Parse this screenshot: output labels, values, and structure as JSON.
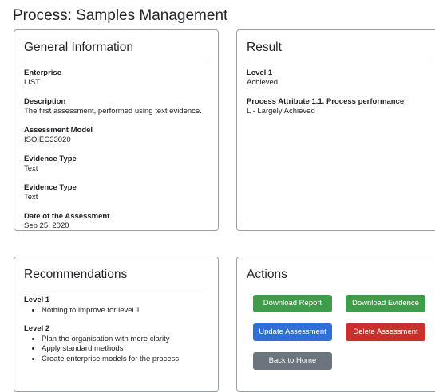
{
  "page": {
    "title": "Process: Samples Management"
  },
  "general_info": {
    "heading": "General Information",
    "fields": [
      {
        "label": "Enterprise",
        "value": "LIST"
      },
      {
        "label": "Description",
        "value": "The first assessment, performed using text evidence."
      },
      {
        "label": "Assessment Model",
        "value": "ISOIEC33020"
      },
      {
        "label": "Evidence Type",
        "value": "Text"
      },
      {
        "label": "Evidence Type",
        "value": "Text"
      },
      {
        "label": "Date of the Assessment",
        "value": "Sep 25, 2020"
      }
    ]
  },
  "result": {
    "heading": "Result",
    "items": [
      {
        "label": "Level 1",
        "value": "Achieved"
      },
      {
        "label": "Process Attribute 1.1. Process performance",
        "value": "L - Largely Achieved"
      }
    ]
  },
  "recommendations": {
    "heading": "Recommendations",
    "groups": [
      {
        "label": "Level 1",
        "items": [
          "Nothing to improve for level 1"
        ]
      },
      {
        "label": "Level 2",
        "items": [
          "Plan the organisation with more clarity",
          "Apply standard methods",
          "Create enterprise models for the process"
        ]
      }
    ]
  },
  "actions": {
    "heading": "Actions",
    "download_report": "Download Report",
    "download_evidence": "Download Evidence",
    "update_assessment": "Update Assessment",
    "delete_assessment": "Delete Assessment",
    "back_to_home": "Back to Home"
  },
  "colors": {
    "success": "#3f9c4a",
    "primary": "#2f6fd6",
    "danger": "#c9302c",
    "secondary": "#6c757d"
  }
}
